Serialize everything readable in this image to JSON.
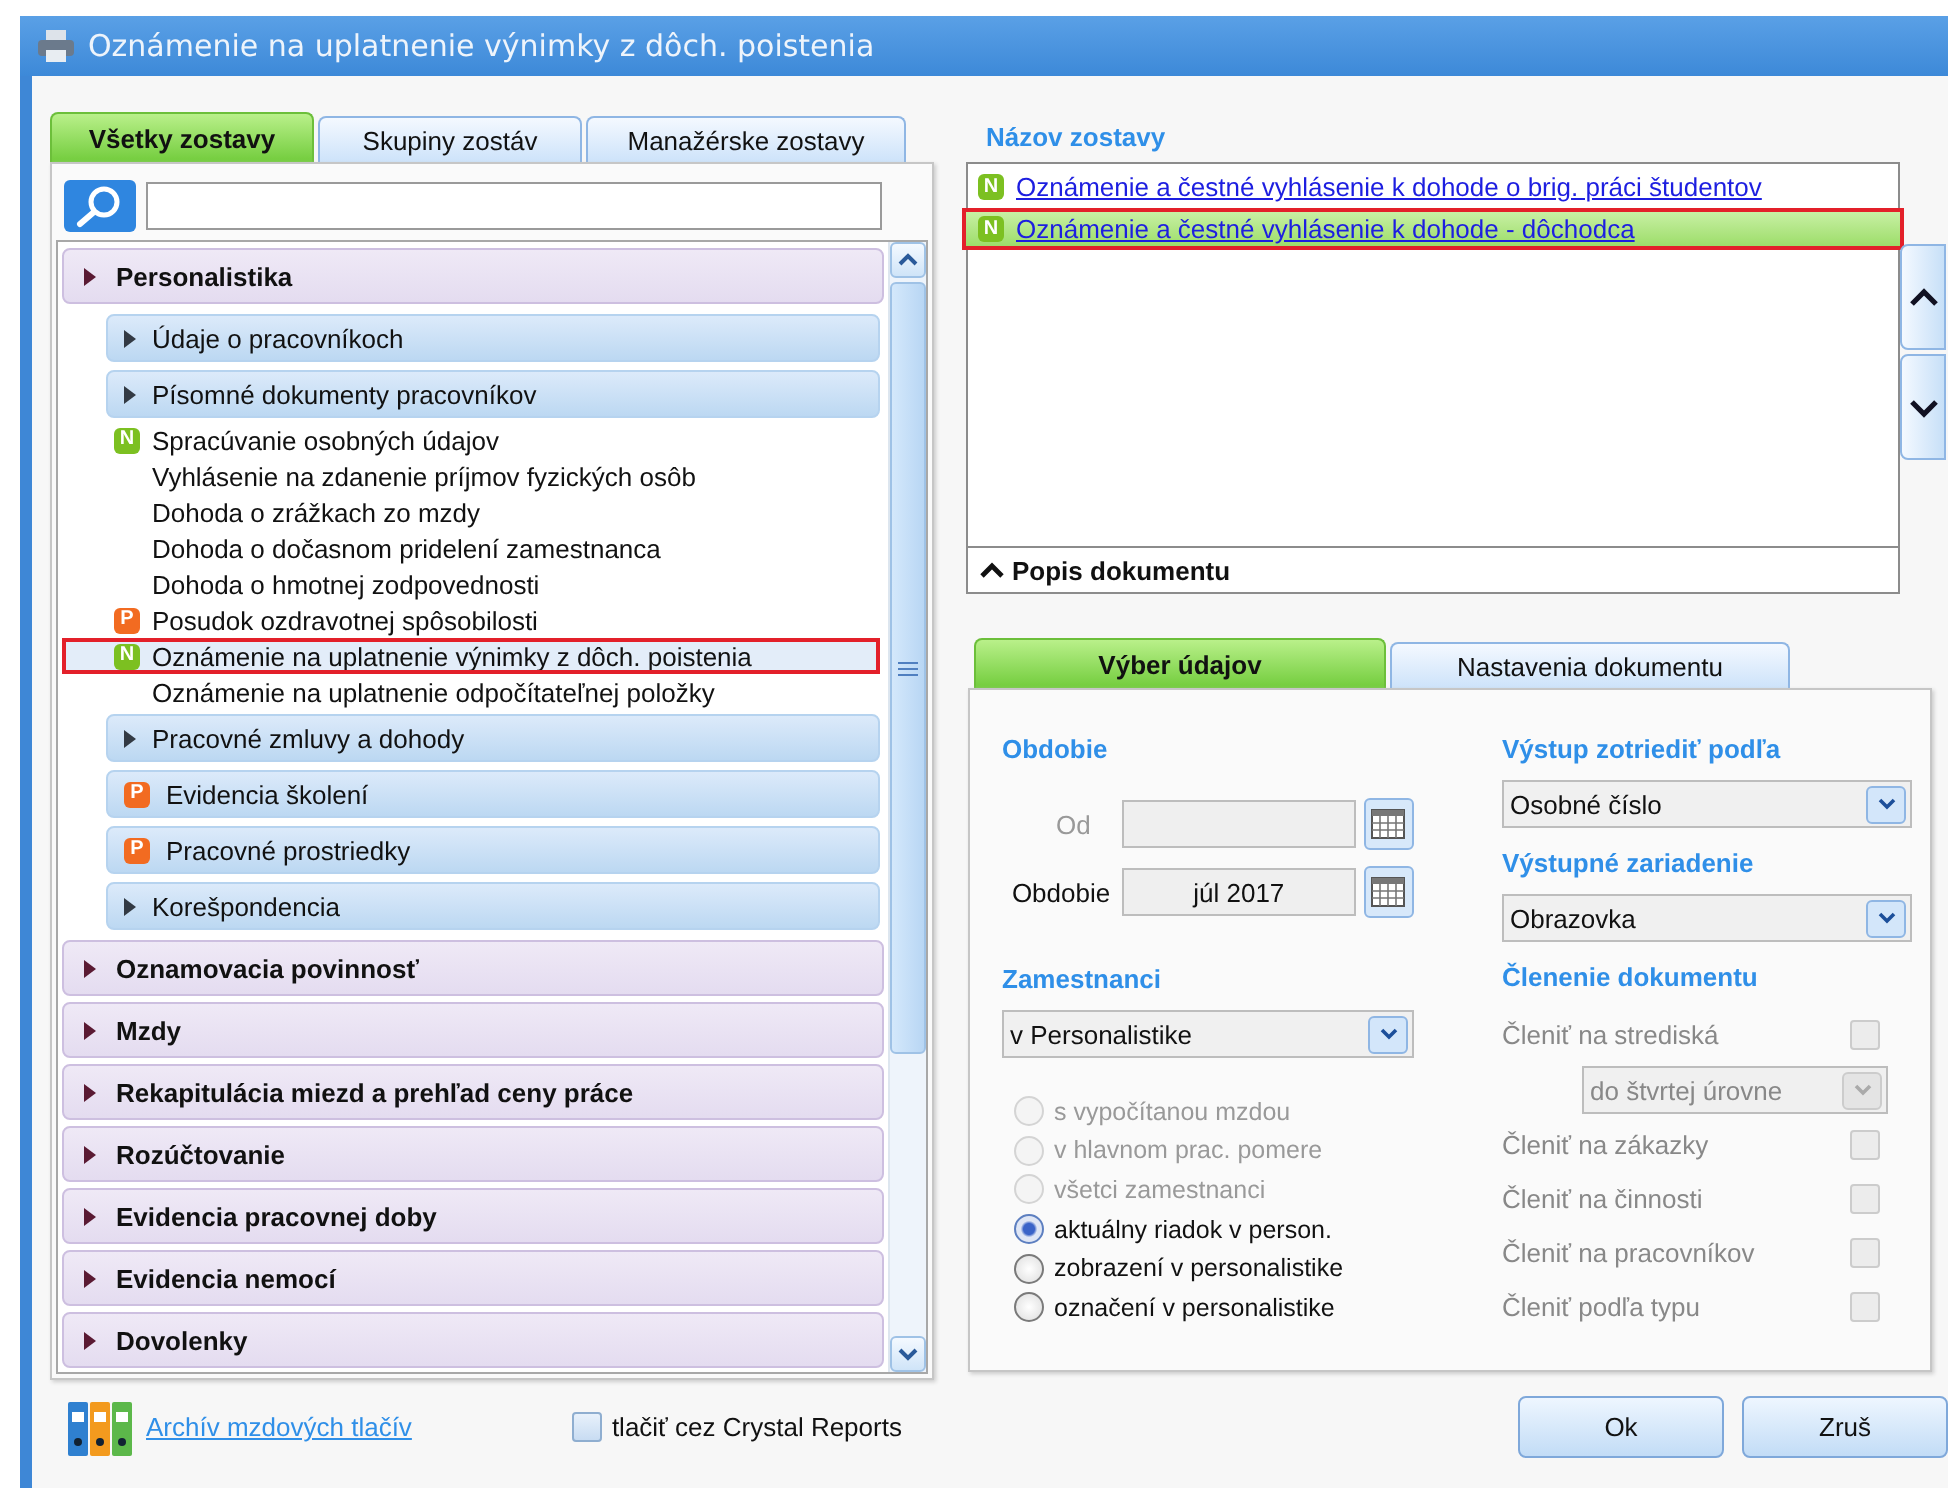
{
  "window": {
    "title": "Oznámenie na uplatnenie výnimky z dôch. poistenia"
  },
  "report_tabs": [
    {
      "label": "Všetky zostavy",
      "selected": true
    },
    {
      "label": "Skupiny zostáv",
      "selected": false
    },
    {
      "label": "Manažérske zostavy",
      "selected": false
    }
  ],
  "tree": [
    {
      "kind": "group",
      "label": "Personalistika",
      "children": [
        {
          "kind": "folder",
          "label": "Údaje o pracovníkoch"
        },
        {
          "kind": "folder",
          "label": "Písomné dokumenty pracovníkov"
        },
        {
          "kind": "report",
          "label": "Spracúvanie osobných údajov",
          "badge": {
            "letter": "N",
            "color": "#7cc021"
          },
          "selected": false
        },
        {
          "kind": "report",
          "label": "Vyhlásenie na zdanenie príjmov fyzických osôb",
          "selected": false
        },
        {
          "kind": "report",
          "label": "Dohoda o zrážkach zo mzdy",
          "selected": false
        },
        {
          "kind": "report",
          "label": "Dohoda o dočasnom pridelení zamestnanca",
          "selected": false
        },
        {
          "kind": "report",
          "label": "Dohoda o hmotnej zodpovednosti",
          "selected": false
        },
        {
          "kind": "report",
          "label": "Posudok ozdravotnej spôsobilosti",
          "badge": {
            "letter": "P",
            "color": "#f26b21"
          },
          "selected": false
        },
        {
          "kind": "report",
          "label": "Oznámenie na uplatnenie výnimky z dôch. poistenia",
          "badge": {
            "letter": "N",
            "color": "#7cc021"
          },
          "selected": true
        },
        {
          "kind": "report",
          "label": "Oznámenie na uplatnenie odpočítateľnej položky",
          "selected": false
        },
        {
          "kind": "folder",
          "label": "Pracovné zmluvy a dohody"
        },
        {
          "kind": "bar-report",
          "label": "Evidencia školení",
          "badge": {
            "letter": "P",
            "color": "#f26b21"
          }
        },
        {
          "kind": "bar-report",
          "label": "Pracovné prostriedky",
          "badge": {
            "letter": "P",
            "color": "#f26b21"
          }
        },
        {
          "kind": "folder",
          "label": "Korešpondencia"
        }
      ]
    },
    {
      "kind": "group",
      "label": "Oznamovacia povinnosť"
    },
    {
      "kind": "group",
      "label": "Mzdy"
    },
    {
      "kind": "group",
      "label": "Rekapitulácia miezd a prehľad ceny práce"
    },
    {
      "kind": "group",
      "label": "Rozúčtovanie"
    },
    {
      "kind": "group",
      "label": "Evidencia pracovnej doby"
    },
    {
      "kind": "group",
      "label": "Evidencia nemocí"
    },
    {
      "kind": "group",
      "label": "Dovolenky"
    }
  ],
  "report_list": {
    "heading": "Názov zostavy",
    "items": [
      {
        "label": "Oznámenie a čestné vyhlásenie k dohode o brig. práci študentov",
        "badge": {
          "letter": "N",
          "color": "#7cc021"
        },
        "selected": false
      },
      {
        "label": "Oznámenie a čestné vyhlásenie k dohode - dôchodca",
        "badge": {
          "letter": "N",
          "color": "#7cc021"
        },
        "selected": true
      }
    ],
    "description": "Popis dokumentu"
  },
  "settings_tabs": [
    {
      "label": "Výber údajov",
      "selected": true
    },
    {
      "label": "Nastavenia dokumentu",
      "selected": false
    }
  ],
  "period": {
    "heading": "Obdobie",
    "fields": [
      {
        "label": "Od",
        "disabled": true
      },
      {
        "label": "Obdobie",
        "value": "júl 2017",
        "disabled": false
      }
    ]
  },
  "employees": {
    "heading": "Zamestnanci",
    "value": "v Personalistike",
    "options": [
      {
        "label": "s vypočítanou mzdou",
        "selected": false,
        "disabled": true
      },
      {
        "label": "v hlavnom prac. pomere",
        "selected": false,
        "disabled": true
      },
      {
        "label": "všetci zamestnanci",
        "selected": false,
        "disabled": true
      },
      {
        "label": "aktuálny riadok v person.",
        "selected": true,
        "disabled": false
      },
      {
        "label": "zobrazení v personalistike",
        "selected": false,
        "disabled": false
      },
      {
        "label": "označení v personalistike",
        "selected": false,
        "disabled": false
      }
    ]
  },
  "sort": {
    "heading": "Výstup zotriediť podľa",
    "value": "Osobné číslo"
  },
  "device": {
    "heading": "Výstupné zariadenie",
    "value": "Obrazovka"
  },
  "breakdown": {
    "heading": "Členenie dokumentu",
    "rows": [
      {
        "kind": "checkbox",
        "label": "Členiť na strediská",
        "checked": false,
        "disabled": true
      },
      {
        "kind": "select",
        "value": "do štvrtej úrovne",
        "disabled": true
      },
      {
        "kind": "checkbox",
        "label": "Členiť na zákazky",
        "checked": false,
        "disabled": true
      },
      {
        "kind": "checkbox",
        "label": "Členiť na činnosti",
        "checked": false,
        "disabled": true
      },
      {
        "kind": "checkbox",
        "label": "Členiť na pracovníkov",
        "checked": false,
        "disabled": true
      },
      {
        "kind": "checkbox",
        "label": "Členiť podľa typu",
        "checked": false,
        "disabled": true
      }
    ]
  },
  "footer": {
    "archive_link": "Archív mzdových tlačív",
    "crystal": {
      "label": "tlačiť cez Crystal Reports",
      "checked": false
    },
    "buttons": [
      "Ok",
      "Zruš"
    ]
  }
}
